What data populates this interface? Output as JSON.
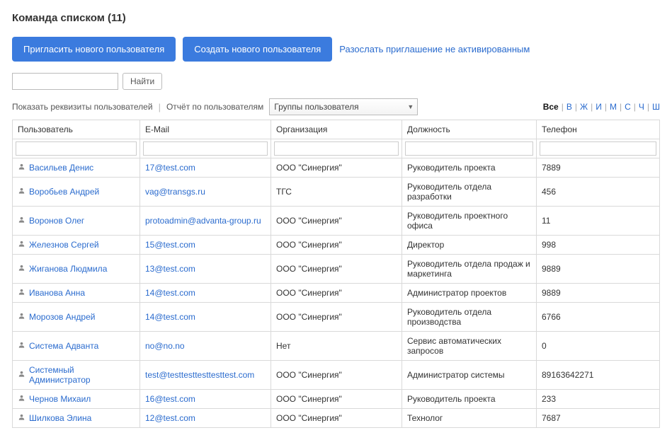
{
  "title": "Команда списком (11)",
  "buttons": {
    "invite": "Пригласить нового пользователя",
    "create": "Создать нового пользователя",
    "send_inactive": "Разослать приглашение не активированным",
    "find": "Найти"
  },
  "controls": {
    "show_requisites": "Показать реквизиты пользователей",
    "report": "Отчёт по пользователям",
    "groups_select": "Группы пользователя"
  },
  "alpha": [
    "Все",
    "В",
    "Ж",
    "И",
    "М",
    "С",
    "Ч",
    "Ш"
  ],
  "alpha_active": "Все",
  "columns": [
    "Пользователь",
    "E-Mail",
    "Организация",
    "Должность",
    "Телефон"
  ],
  "rows": [
    {
      "user": "Васильев Денис",
      "email": "17@test.com",
      "org": "ООО \"Синергия\"",
      "pos": "Руководитель проекта",
      "tel": "7889"
    },
    {
      "user": "Воробьев Андрей",
      "email": "vag@transgs.ru",
      "org": "ТГС",
      "pos": "Руководитель отдела разработки",
      "tel": "456"
    },
    {
      "user": "Воронов Олег",
      "email": "protoadmin@advanta-group.ru",
      "org": "ООО \"Синергия\"",
      "pos": "Руководитель проектного офиса",
      "tel": "11"
    },
    {
      "user": "Железнов Сергей",
      "email": "15@test.com",
      "org": "ООО \"Синергия\"",
      "pos": "Директор",
      "tel": "998"
    },
    {
      "user": "Жиганова Людмила",
      "email": "13@test.com",
      "org": "ООО \"Синергия\"",
      "pos": "Руководитель отдела продаж и маркетинга",
      "tel": "9889"
    },
    {
      "user": "Иванова Анна",
      "email": "14@test.com",
      "org": "ООО \"Синергия\"",
      "pos": "Администратор проектов",
      "tel": "9889"
    },
    {
      "user": "Морозов Андрей",
      "email": "14@test.com",
      "org": "ООО \"Синергия\"",
      "pos": "Руководитель отдела производства",
      "tel": "6766"
    },
    {
      "user": "Система Адванта",
      "email": "no@no.no",
      "org": "Нет",
      "pos": "Сервис автоматических запросов",
      "tel": "0"
    },
    {
      "user": "Системный Администратор",
      "email": "test@testtesttesttesttest.com",
      "org": "ООО \"Синергия\"",
      "pos": "Администратор системы",
      "tel": "89163642271"
    },
    {
      "user": "Чернов Михаил",
      "email": "16@test.com",
      "org": "ООО \"Синергия\"",
      "pos": "Руководитель проекта",
      "tel": "233"
    },
    {
      "user": "Шилкова Элина",
      "email": "12@test.com",
      "org": "ООО \"Синергия\"",
      "pos": "Технолог",
      "tel": "7687"
    }
  ]
}
